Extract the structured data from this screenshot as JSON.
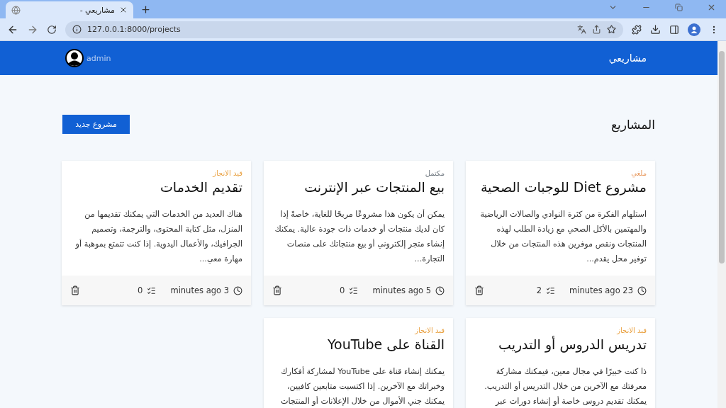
{
  "browser": {
    "tab_title": "مشاريعي -",
    "url": "127.0.0.1:8000/projects"
  },
  "navbar": {
    "brand": "مشاريعي",
    "user": "admin"
  },
  "page": {
    "heading": "المشاريع",
    "new_button": "مشروع جديد"
  },
  "projects": [
    {
      "status": "ملغي",
      "color": "#e8995e",
      "title": "مشروع Diet للوجبات الصحية",
      "description": "استلهام الفكرة من كثرة النوادي والصالات الرياضية والمهتمين بالأكل الصحي مع زيادة الطلب لهذه المنتجات ونقص موفرين هذه المنتجات من خلال توفير محل يقدم...",
      "time": "minutes ago 23",
      "tasks": "2"
    },
    {
      "status": "مكتمل",
      "color": "#6c757d",
      "title": "بيع المنتجات عبر الإنترنت",
      "description": "يمكن أن يكون هذا مشروعًا مربحًا للغاية، خاصةً إذا كان لديك منتجات أو خدمات ذات جودة عالية. يمكنك إنشاء متجر إلكتروني أو بيع منتجاتك على منصات التجارة...",
      "time": "minutes ago 5",
      "tasks": "0"
    },
    {
      "status": "قيد الانجاز",
      "color": "#e9a03f",
      "title": "تقديم الخدمات",
      "description": "هناك العديد من الخدمات التي يمكنك تقديمها من المنزل، مثل كتابة المحتوى، والترجمة، وتصميم الجرافيك، والأعمال اليدوية. إذا كنت تتمتع بموهبة أو مهارة معي...",
      "time": "minutes ago 3",
      "tasks": "0"
    },
    {
      "status": "قيد الانجاز",
      "color": "#e9a03f",
      "title": "تدريس الدروس أو التدريب",
      "description": "ذا كنت خبيرًا في مجال معين، فيمكنك مشاركة معرفتك مع الآخرين من خلال التدريس أو التدريب. يمكنك تقديم دروس خاصة أو إنشاء دورات عبر"
    },
    {
      "status": "قيد الانجاز",
      "color": "#e9a03f",
      "title": "القناة على YouTube",
      "description": "يمكنك إنشاء قناة على YouTube لمشاركة أفكارك وخبراتك مع الآخرين. إذا اكتسبت متابعين كافيين، يمكنك جني الأموال من خلال الإعلانات أو المنتجات"
    }
  ]
}
